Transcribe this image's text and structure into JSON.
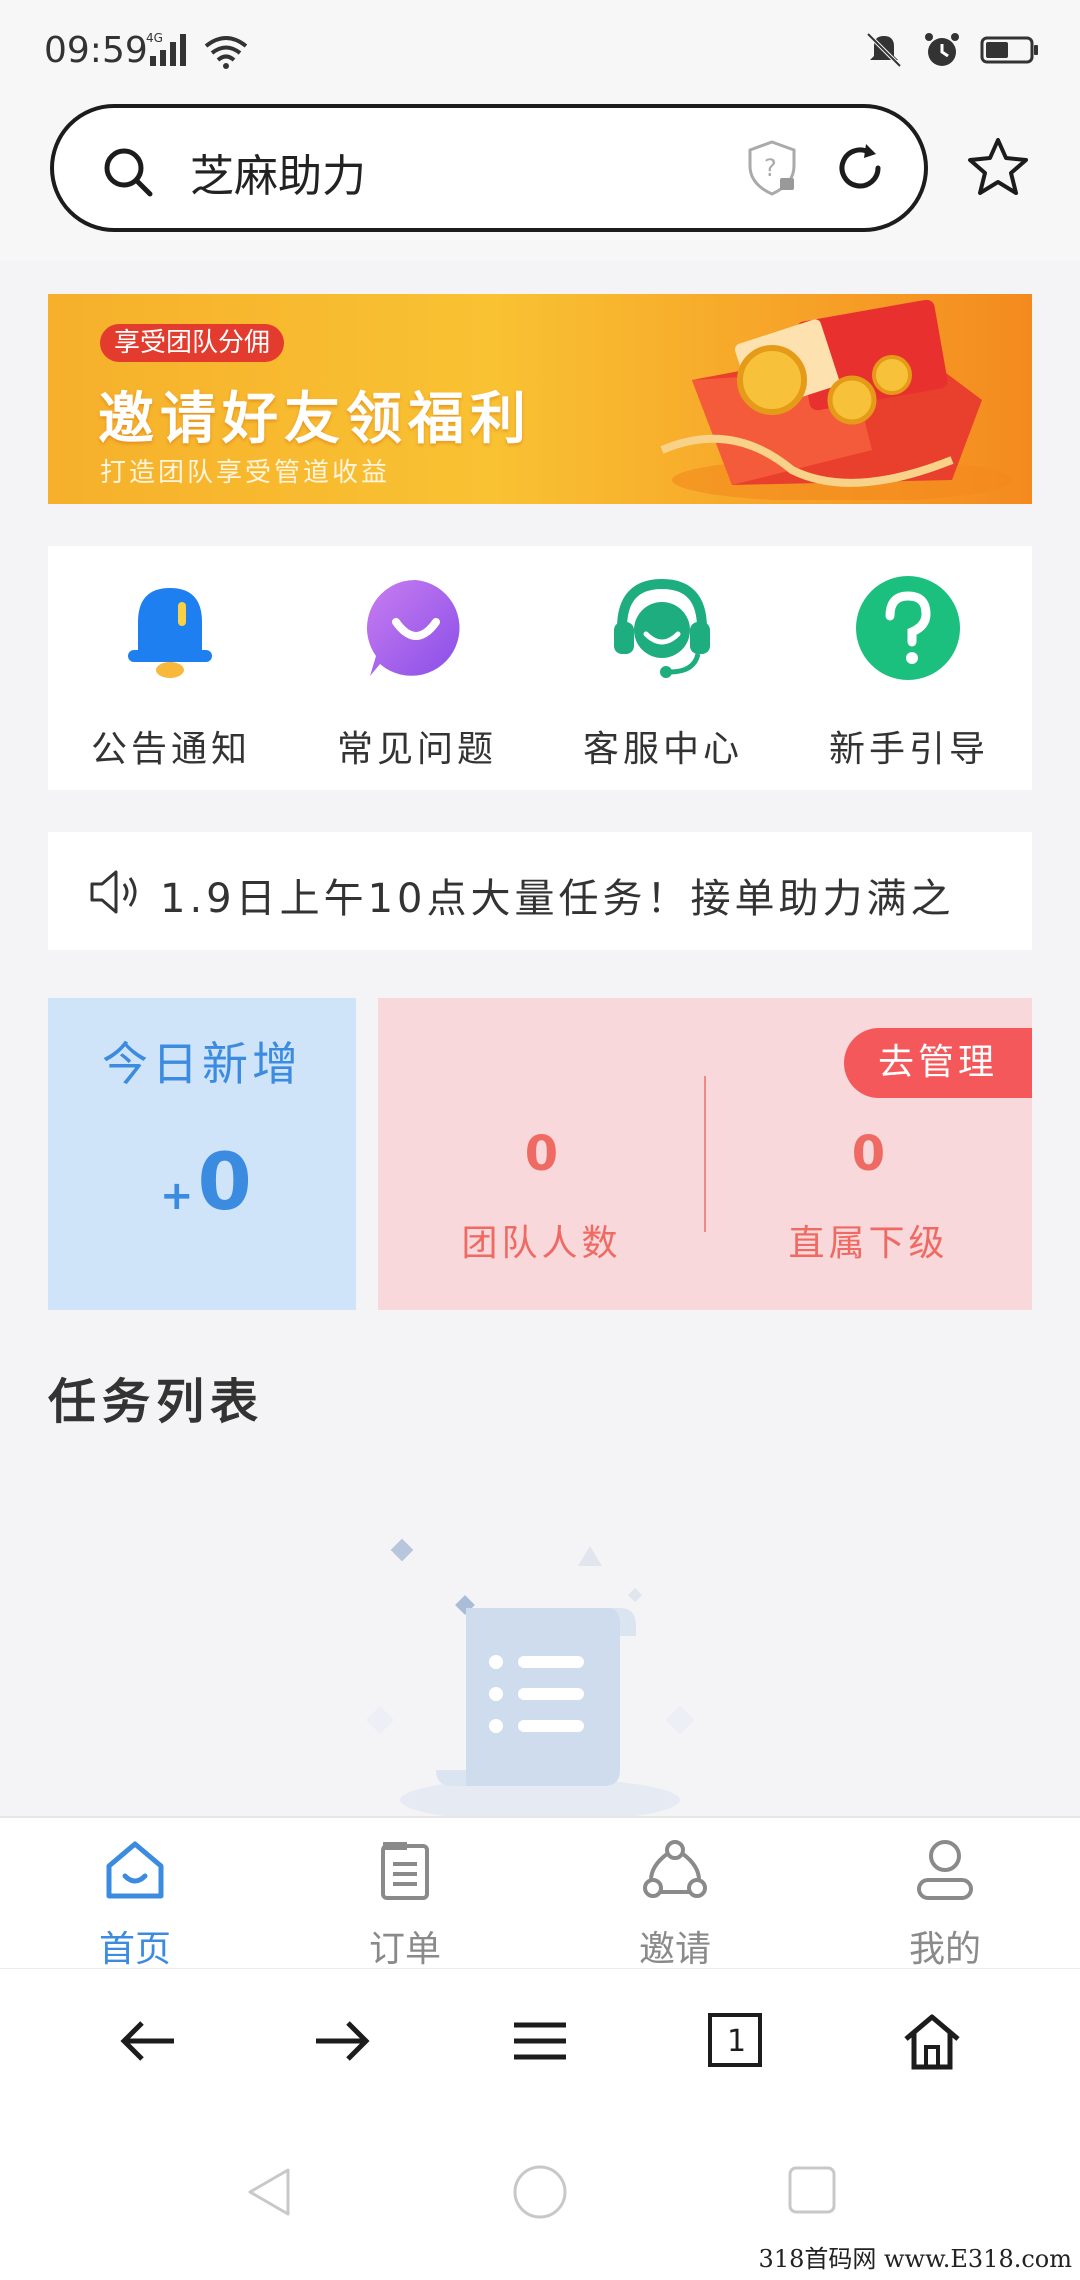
{
  "status_bar": {
    "time": "09:59",
    "network": "4G"
  },
  "browser": {
    "address_text": "芝麻助力"
  },
  "banner": {
    "tag": "享受团队分佣",
    "title": "邀请好友领福利",
    "subtitle": "打造团队享受管道收益"
  },
  "quick_menu": {
    "items": [
      {
        "label": "公告通知",
        "icon": "bell-icon"
      },
      {
        "label": "常见问题",
        "icon": "chat-bubble-icon"
      },
      {
        "label": "客服中心",
        "icon": "headset-icon"
      },
      {
        "label": "新手引导",
        "icon": "question-icon"
      }
    ]
  },
  "notice": {
    "text": "1.9日上午10点大量任务！接单助力满之"
  },
  "stats": {
    "today_label": "今日新增",
    "today_plus": "+",
    "today_value": "0",
    "manage_label": "去管理",
    "team_count_value": "0",
    "team_count_label": "团队人数",
    "direct_value": "0",
    "direct_label": "直属下级"
  },
  "tasks": {
    "title": "任务列表"
  },
  "tabs": [
    {
      "label": "首页",
      "icon": "home-icon",
      "active": true
    },
    {
      "label": "订单",
      "icon": "order-icon",
      "active": false
    },
    {
      "label": "邀请",
      "icon": "share-icon",
      "active": false
    },
    {
      "label": "我的",
      "icon": "user-icon",
      "active": false
    }
  ],
  "browser_nav": {
    "tab_count": "1"
  },
  "watermark": "318首码网  www.E318.com",
  "colors": {
    "accent_blue": "#3b8be0",
    "accent_red": "#f4585a",
    "banner_orange": "#f7a92a"
  }
}
